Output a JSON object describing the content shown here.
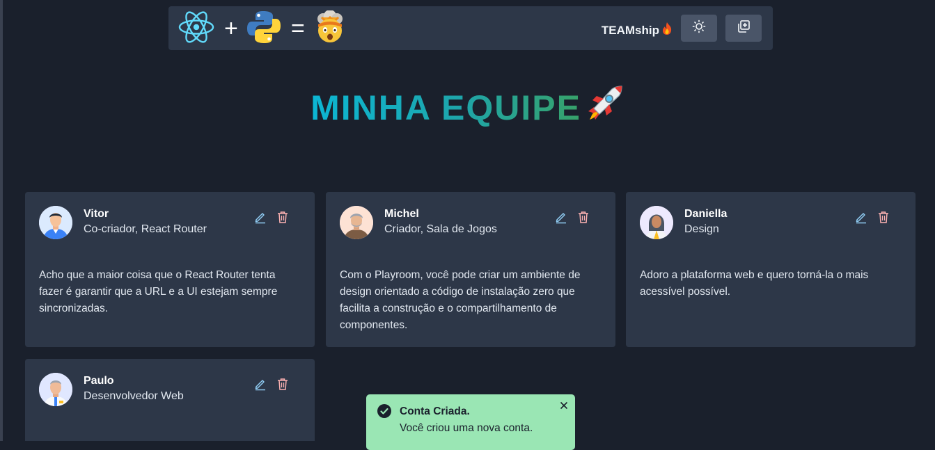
{
  "header": {
    "brand": "TEAMship",
    "logo_plus": "+",
    "logo_equals": "=",
    "icons": {
      "react": "react-logo-icon",
      "python": "python-logo-icon",
      "face": "exploding-head-emoji",
      "fire": "fire-emoji",
      "theme": "sun-icon",
      "add": "add-square-icon"
    }
  },
  "page": {
    "title": "MINHA EQUIPE",
    "title_icon": "rocket-emoji"
  },
  "cards": [
    {
      "name": "Vitor",
      "role": "Co-criador, React Router",
      "quote": "Acho que a maior coisa que o React Router tenta fazer é garantir que a URL e a UI estejam sempre sincronizadas."
    },
    {
      "name": "Michel",
      "role": "Criador, Sala de Jogos",
      "quote": "Com o Playroom, você pode criar um ambiente de design orientado a código de instalação zero que facilita a construção e o compartilhamento de componentes."
    },
    {
      "name": "Daniella",
      "role": "Design",
      "quote": "Adoro a plataforma web e quero torná-la o mais acessível possível."
    },
    {
      "name": "Paulo",
      "role": "Desenvolvedor Web",
      "quote": ""
    }
  ],
  "toast": {
    "title": "Conta Criada.",
    "message": "Você criou uma nova conta.",
    "status": "success"
  },
  "colors": {
    "background": "#1a202c",
    "card": "#2d3748",
    "edit_icon": "#90cdf4",
    "delete_icon": "#feb2b2",
    "toast_bg": "#9ae6b4",
    "title_gradient_start": "#0cb6d4",
    "title_gradient_end": "#37a169"
  }
}
